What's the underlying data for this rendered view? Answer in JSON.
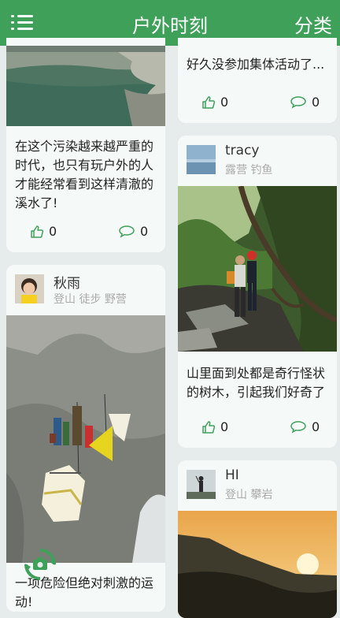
{
  "header": {
    "title": "户外时刻",
    "category_label": "分类"
  },
  "colors": {
    "primary": "#3fa05a",
    "background": "#e6eceb",
    "card": "#f5faf8",
    "icon": "#3fa05a"
  },
  "posts": [
    {
      "text": "在这个污染越来越严重的时代，也只有玩户外的人才能经常看到这样清澈的溪水了!",
      "likes": "0",
      "comments": "0"
    },
    {
      "user": "秋雨",
      "tags": "登山 徒步 野营",
      "text": "一项危险但绝对刺激的运动!"
    },
    {
      "text": "好久没参加集体活动了...",
      "likes": "0",
      "comments": "0"
    },
    {
      "user": "tracy",
      "tags": "露营 钓鱼",
      "text": "山里面到处都是奇行怪状的树木，引起我们好奇了",
      "likes": "0",
      "comments": "0"
    },
    {
      "user": "HI",
      "tags": "登山 攀岩"
    }
  ],
  "icons": {
    "menu": "menu-icon",
    "like": "thumbs-up-icon",
    "comment": "comment-bubble-icon",
    "camera": "camera-icon"
  }
}
